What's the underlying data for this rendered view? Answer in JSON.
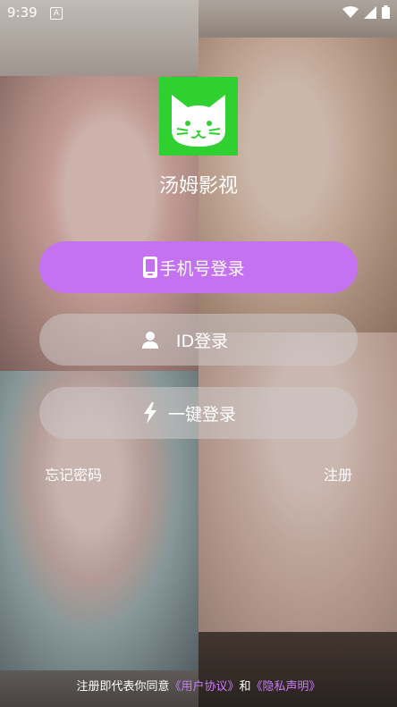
{
  "status_bar": {
    "time": "9:39",
    "notification_icon": "A",
    "icons": [
      "wifi-icon",
      "cellular-icon",
      "battery-icon"
    ]
  },
  "app": {
    "name": "汤姆影视",
    "logo_icon": "cat-icon",
    "logo_color": "#2FD02F"
  },
  "buttons": {
    "phone_login": "手机号登录",
    "id_login": "ID登录",
    "one_click_login": "一键登录"
  },
  "links": {
    "forgot_password": "忘记密码",
    "register": "注册"
  },
  "agreement": {
    "prefix": "注册即代表你同意",
    "user_agreement": "《用户协议》",
    "conjunction": "和",
    "privacy_policy": "《隐私声明》"
  },
  "colors": {
    "primary": "#C572F2",
    "link_accent": "#C77DF5"
  }
}
